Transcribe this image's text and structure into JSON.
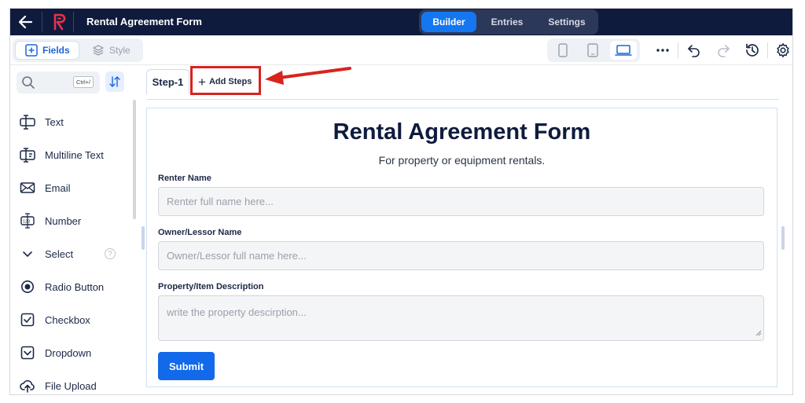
{
  "header": {
    "title": "Rental Agreement Form",
    "tabs": [
      {
        "label": "Builder",
        "active": true
      },
      {
        "label": "Entries",
        "active": false
      },
      {
        "label": "Settings",
        "active": false
      }
    ]
  },
  "toolbar": {
    "fields_label": "Fields",
    "style_label": "Style",
    "devices": [
      "mobile-icon",
      "tablet-icon",
      "desktop-icon"
    ],
    "active_device": "desktop-icon"
  },
  "sidebar": {
    "search_placeholder": "",
    "shortcut": "Ctrl+/",
    "items": [
      {
        "label": "Text",
        "icon": "text-field-icon"
      },
      {
        "label": "Multiline Text",
        "icon": "multiline-text-icon"
      },
      {
        "label": "Email",
        "icon": "email-icon"
      },
      {
        "label": "Number",
        "icon": "number-icon"
      },
      {
        "label": "Select",
        "icon": "chevron-down-icon"
      },
      {
        "label": "Radio Button",
        "icon": "radio-icon"
      },
      {
        "label": "Checkbox",
        "icon": "checkbox-icon"
      },
      {
        "label": "Dropdown",
        "icon": "dropdown-icon"
      },
      {
        "label": "File Upload",
        "icon": "upload-icon"
      }
    ],
    "help_glyph": "?"
  },
  "steps": {
    "current": "Step-1",
    "add_label": "Add Steps"
  },
  "form": {
    "title": "Rental Agreement Form",
    "subtitle": "For property or equipment rentals.",
    "fields": [
      {
        "label": "Renter Name",
        "placeholder": "Renter full name here..."
      },
      {
        "label": "Owner/Lessor Name",
        "placeholder": "Owner/Lessor full name here..."
      },
      {
        "label": "Property/Item Description",
        "placeholder": "write the property descirption..."
      }
    ],
    "submit_label": "Submit"
  },
  "colors": {
    "header_bg": "#0f1b3d",
    "accent": "#1269ea",
    "annotation": "#d8231f"
  }
}
